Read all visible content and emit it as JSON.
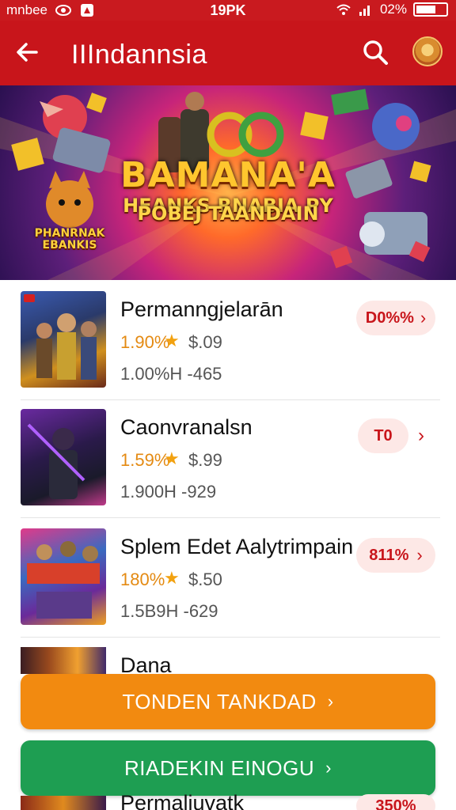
{
  "status_bar": {
    "left_text": "mnbee",
    "time": "19PK",
    "battery_text": "02%"
  },
  "app_bar": {
    "title": "IIIndannsia"
  },
  "banner": {
    "title": "BAMANA'A",
    "subtitle_line1": "HEANKS RNABIA PY",
    "subtitle_line2": "POBEJ TAANDAIN",
    "side_logo_line1": "PHANRNAK",
    "side_logo_line2": "EBANKIS"
  },
  "items": [
    {
      "name": "Permanngjelarān",
      "rating": "1.90%",
      "price": "$.09",
      "meta": "1.00%H  -465",
      "action": "D0%%"
    },
    {
      "name": "Caonvranalsn",
      "rating": "1.59%",
      "price": "$.99",
      "meta": "1.900H  -929",
      "action": "T0"
    },
    {
      "name": "Splem Edet Aalytrimpain",
      "rating": "180%",
      "price": "$.50",
      "meta": "1.5B9H  -629",
      "action": "811%"
    }
  ],
  "peek_item": {
    "name": "Dana"
  },
  "buttons": {
    "primary": "TONDEN TANKDAD",
    "secondary": "RIADEKIN EINOGU"
  },
  "partial_item": {
    "name": "Permaliuvatk",
    "action": "350%"
  },
  "colors": {
    "brand_red": "#c8151b",
    "orange": "#f28a10",
    "green": "#1e9e52"
  }
}
